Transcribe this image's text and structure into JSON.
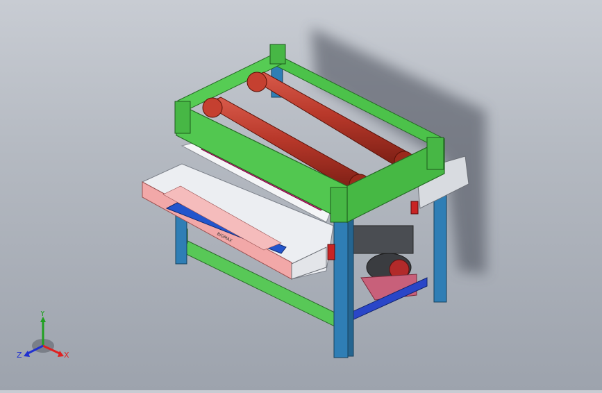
{
  "model_view": {
    "nameplate_text": "BIGMAX",
    "colors": {
      "background_top": "#c8ccd3",
      "background_bottom": "#9da3ad",
      "frame_green": "#4cc24a",
      "leg_blue": "#2f7eb5",
      "roller_red": "#b8382a",
      "magenta_roller": "#e0127a",
      "pink_table": "#f2a8a8",
      "blue_rail": "#2255cc",
      "white_plate": "#eceef2"
    }
  },
  "triad": {
    "x_label": "X",
    "y_label": "Y",
    "z_label": "Z",
    "x_color": "#e02020",
    "y_color": "#20a020",
    "z_color": "#2030d0"
  }
}
